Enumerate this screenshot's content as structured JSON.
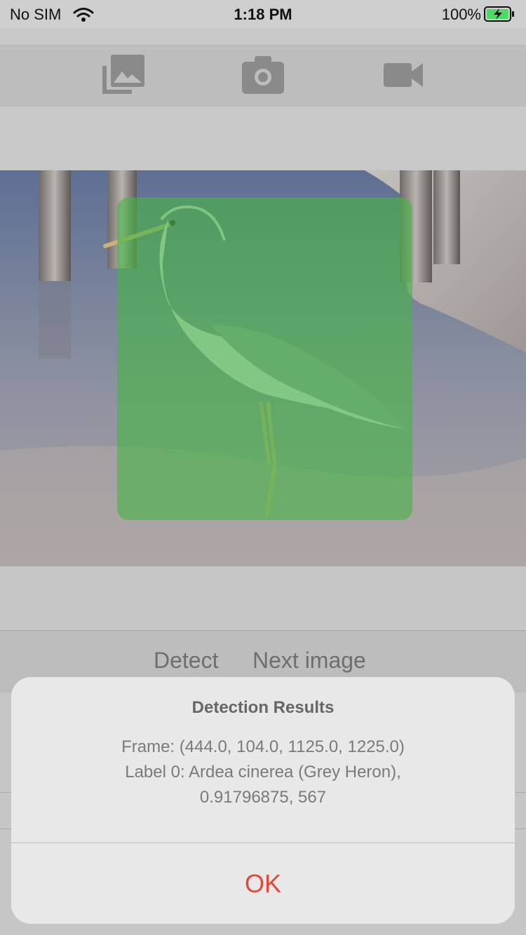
{
  "status_bar": {
    "carrier": "No SIM",
    "time": "1:18 PM",
    "battery_percent": "100%"
  },
  "toolbar": {
    "icons": [
      "photo-library-icon",
      "camera-icon",
      "video-camera-icon"
    ]
  },
  "actions": {
    "detect_label": "Detect",
    "next_image_label": "Next image"
  },
  "alert": {
    "title": "Detection Results",
    "message": "Frame: (444.0, 104.0, 1125.0, 1225.0)\nLabel 0: Ardea cinerea (Grey Heron),\n0.91796875, 567",
    "ok_label": "OK"
  },
  "colors": {
    "detection_overlay": "#46b446",
    "alert_ok": "#e2473a"
  }
}
